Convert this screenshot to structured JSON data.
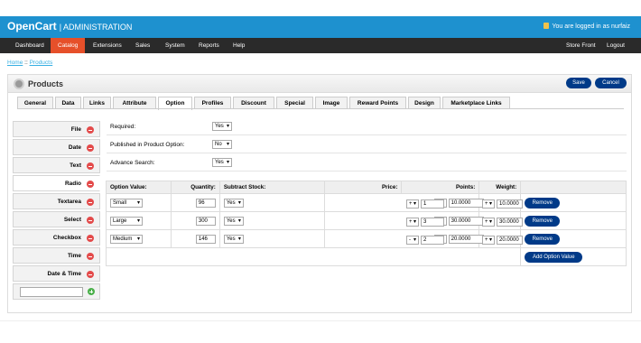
{
  "header": {
    "brand": "OpenCart",
    "brand_sub": "| ADMINISTRATION",
    "logged_in": "You are logged in as nurfaiz"
  },
  "menu": {
    "items": [
      "Dashboard",
      "Catalog",
      "Extensions",
      "Sales",
      "System",
      "Reports",
      "Help"
    ],
    "right": [
      "Store Front",
      "Logout"
    ]
  },
  "breadcrumb": {
    "home": "Home",
    "sep": " :: ",
    "current": "Products"
  },
  "box": {
    "title": "Products",
    "save": "Save",
    "cancel": "Cancel"
  },
  "tabs": [
    "General",
    "Data",
    "Links",
    "Attribute",
    "Option",
    "Profiles",
    "Discount",
    "Special",
    "Image",
    "Reward Points",
    "Design",
    "Marketplace Links"
  ],
  "option_types": [
    "File",
    "Date",
    "Text",
    "Radio",
    "Textarea",
    "Select",
    "Checkbox",
    "Time",
    "Date & Time"
  ],
  "fields": {
    "required_label": "Required:",
    "required_value": "Yes",
    "published_label": "Published in Product Option:",
    "published_value": "No",
    "advance_label": "Advance Search:",
    "advance_value": "Yes"
  },
  "table": {
    "headers": [
      "Option Value:",
      "Quantity:",
      "Subtract Stock:",
      "Price:",
      "Points:",
      "Weight:"
    ],
    "rows": [
      {
        "value": "Small",
        "qty": "96",
        "subtract": "Yes",
        "price_prefix": "+",
        "price": "10.0000",
        "points_prefix": "+",
        "points": "1",
        "weight_prefix": "+",
        "weight": "10.0000"
      },
      {
        "value": "Large",
        "qty": "300",
        "subtract": "Yes",
        "price_prefix": "+",
        "price": "30.0000",
        "points_prefix": "+",
        "points": "3",
        "weight_prefix": "+",
        "weight": "30.0000"
      },
      {
        "value": "Medium",
        "qty": "146",
        "subtract": "Yes",
        "price_prefix": "+",
        "price": "20.0000",
        "points_prefix": "-",
        "points": "2",
        "weight_prefix": "+",
        "weight": "20.0000"
      }
    ],
    "remove_label": "Remove",
    "add_label": "Add Option Value"
  }
}
